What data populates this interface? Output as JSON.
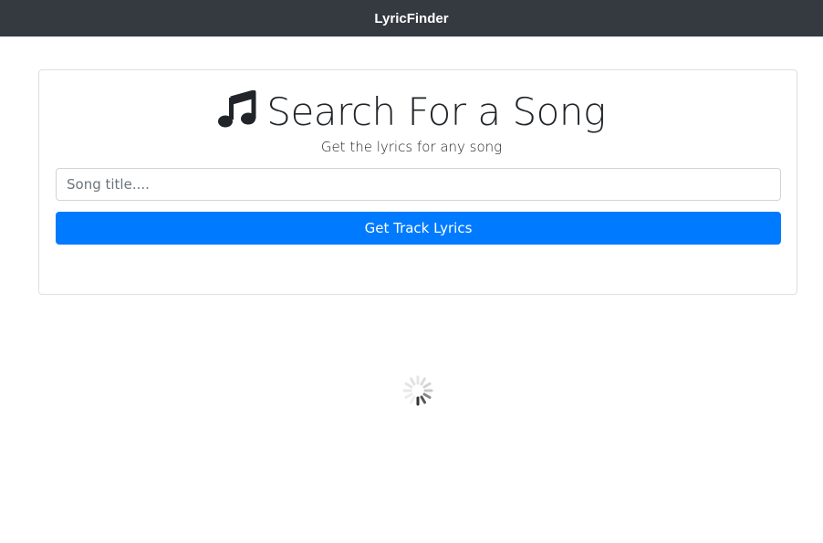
{
  "navbar": {
    "brand": "LyricFinder"
  },
  "search_card": {
    "icon": "music-note-icon",
    "title": "Search For a Song",
    "subtitle": "Get the lyrics for any song",
    "input_placeholder": "Song title....",
    "input_value": "",
    "button_label": "Get Track Lyrics"
  },
  "loading": {
    "icon": "spinner-icon"
  },
  "colors": {
    "navbar": "#343a40",
    "primary": "#007bff",
    "text": "#212529"
  }
}
